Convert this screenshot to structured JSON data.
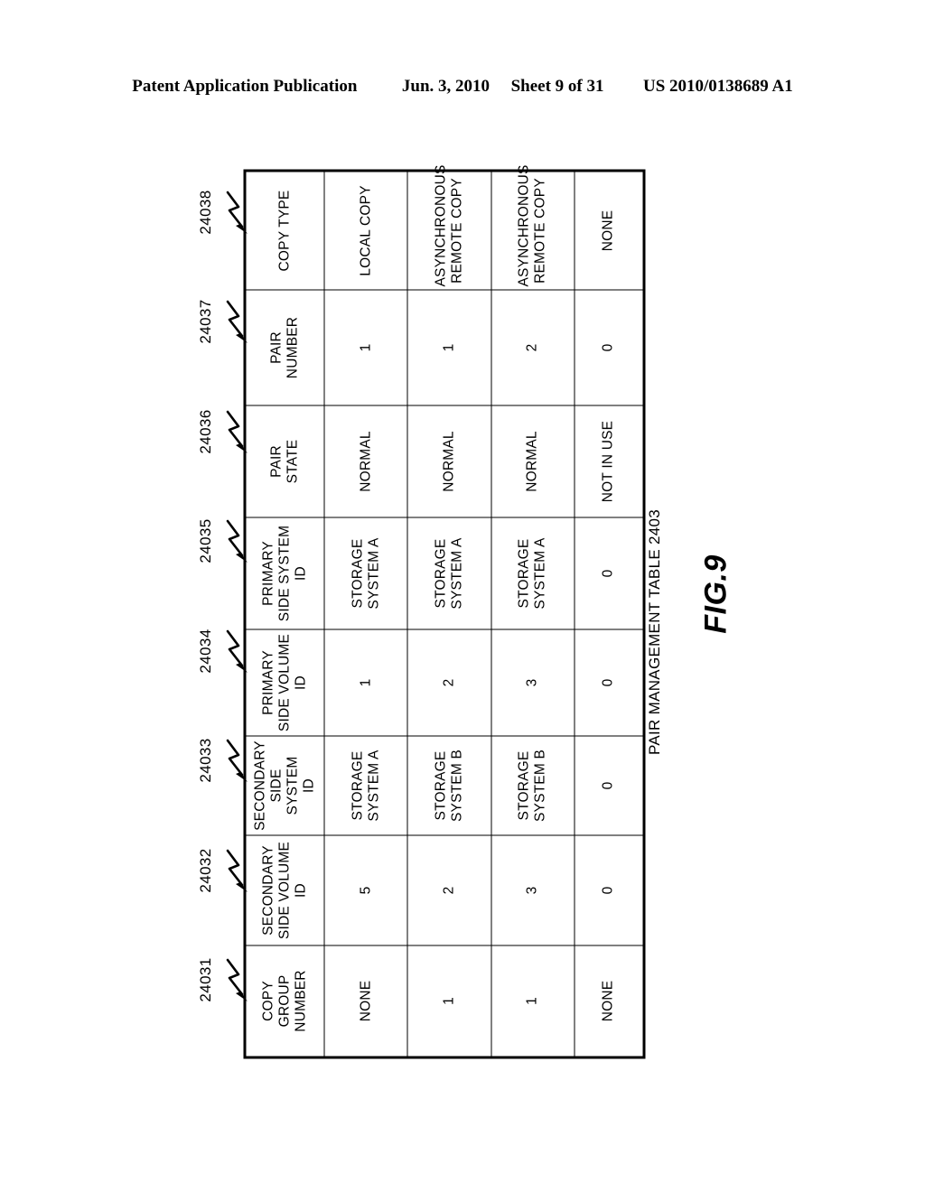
{
  "page_header": {
    "publication": "Patent Application Publication",
    "date": "Jun. 3, 2010",
    "sheet": "Sheet 9 of 31",
    "patent_number": "US 2010/0138689 A1"
  },
  "figure": {
    "label": "FIG.9",
    "caption": "PAIR MANAGEMENT TABLE 2403"
  },
  "table": {
    "fields": [
      {
        "ref": "24031",
        "name": "COPY TYPE"
      },
      {
        "ref": "24032",
        "name": "PAIR NUMBER"
      },
      {
        "ref": "24033",
        "name": "PAIR STATE"
      },
      {
        "ref": "24034",
        "name": "PRIMARY SIDE SYSTEM ID"
      },
      {
        "ref": "24035",
        "name": "PRIMARY SIDE VOLUME ID"
      },
      {
        "ref": "24036",
        "name": "SECONDARY SIDE SYSTEM ID"
      },
      {
        "ref": "24037",
        "name": "SECONDARY SIDE VOLUME ID"
      },
      {
        "ref": "24038",
        "name": "COPY GROUP NUMBER"
      }
    ],
    "field_labels_lines": [
      [
        "COPY TYPE"
      ],
      [
        "PAIR",
        "NUMBER"
      ],
      [
        "PAIR",
        "STATE"
      ],
      [
        "PRIMARY",
        "SIDE SYSTEM",
        "ID"
      ],
      [
        "PRIMARY",
        "SIDE VOLUME",
        "ID"
      ],
      [
        "SECONDARY",
        "SIDE SYSTEM",
        "ID"
      ],
      [
        "SECONDARY",
        "SIDE VOLUME",
        "ID"
      ],
      [
        "COPY",
        "GROUP",
        "NUMBER"
      ]
    ],
    "rows": [
      {
        "copy_type": "LOCAL COPY",
        "copy_type_lines": [
          "LOCAL COPY"
        ],
        "pair_number": "1",
        "pair_state": "NORMAL",
        "primary_side_system_id": "STORAGE SYSTEM A",
        "primary_side_system_id_lines": [
          "STORAGE",
          "SYSTEM A"
        ],
        "primary_side_volume_id": "1",
        "secondary_side_system_id": "STORAGE SYSTEM A",
        "secondary_side_system_id_lines": [
          "STORAGE",
          "SYSTEM A"
        ],
        "secondary_side_volume_id": "5",
        "copy_group_number": "NONE"
      },
      {
        "copy_type": "ASYNCHRONOUS REMOTE COPY",
        "copy_type_lines": [
          "ASYNCHRONOUS",
          "REMOTE COPY"
        ],
        "pair_number": "1",
        "pair_state": "NORMAL",
        "primary_side_system_id": "STORAGE SYSTEM A",
        "primary_side_system_id_lines": [
          "STORAGE",
          "SYSTEM A"
        ],
        "primary_side_volume_id": "2",
        "secondary_side_system_id": "STORAGE SYSTEM B",
        "secondary_side_system_id_lines": [
          "STORAGE",
          "SYSTEM B"
        ],
        "secondary_side_volume_id": "2",
        "copy_group_number": "1"
      },
      {
        "copy_type": "ASYNCHRONOUS REMOTE COPY",
        "copy_type_lines": [
          "ASYNCHRONOUS",
          "REMOTE COPY"
        ],
        "pair_number": "2",
        "pair_state": "NORMAL",
        "primary_side_system_id": "STORAGE SYSTEM A",
        "primary_side_system_id_lines": [
          "STORAGE",
          "SYSTEM A"
        ],
        "primary_side_volume_id": "3",
        "secondary_side_system_id": "STORAGE SYSTEM B",
        "secondary_side_system_id_lines": [
          "STORAGE",
          "SYSTEM B"
        ],
        "secondary_side_volume_id": "3",
        "copy_group_number": "1"
      },
      {
        "copy_type": "NONE",
        "copy_type_lines": [
          "NONE"
        ],
        "pair_number": "0",
        "pair_state": "NOT IN USE",
        "primary_side_system_id": "0",
        "primary_side_system_id_lines": [
          "0"
        ],
        "primary_side_volume_id": "0",
        "secondary_side_system_id": "0",
        "secondary_side_system_id_lines": [
          "0"
        ],
        "secondary_side_volume_id": "0",
        "copy_group_number": "NONE"
      }
    ]
  },
  "colors": {
    "ink": "#000000",
    "paper": "#ffffff"
  }
}
